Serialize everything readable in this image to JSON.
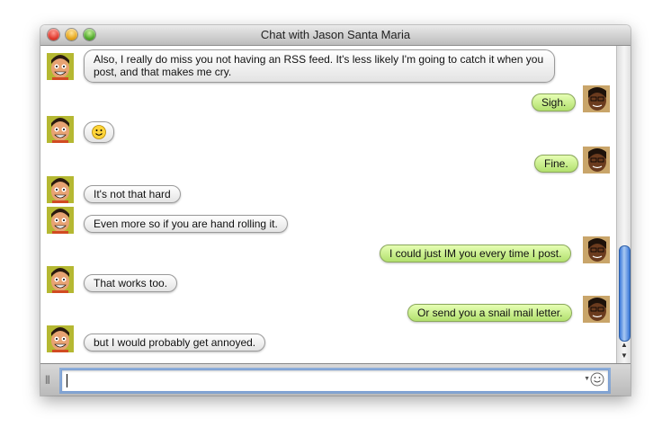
{
  "window": {
    "title": "Chat with Jason Santa Maria"
  },
  "messages": [
    {
      "side": "left",
      "text": "Also, I really do miss you not having an RSS feed. It's less likely I'm going to catch it when you post, and that makes me cry.",
      "avatar": "cartoon-face-icon"
    },
    {
      "side": "right",
      "text": "Sigh.",
      "avatar": "cartoon-face-icon"
    },
    {
      "side": "left",
      "text": "",
      "emoji": "🙂",
      "avatar": "cartoon-face-icon"
    },
    {
      "side": "right",
      "text": "Fine.",
      "avatar": "cartoon-face-icon"
    },
    {
      "side": "left",
      "text": "It's not that hard",
      "avatar": "cartoon-face-icon"
    },
    {
      "side": "left",
      "text": "Even more so if you are hand rolling it.",
      "avatar": "cartoon-face-icon"
    },
    {
      "side": "right",
      "text": "I could just IM you every time I post.",
      "avatar": "cartoon-face-icon"
    },
    {
      "side": "left",
      "text": "That works too.",
      "avatar": "cartoon-face-icon"
    },
    {
      "side": "right",
      "text": "Or send you a snail mail letter.",
      "avatar": "cartoon-face-icon"
    },
    {
      "side": "left",
      "text": "but I would probably get annoyed.",
      "avatar": "cartoon-face-icon"
    }
  ],
  "input": {
    "value": ""
  },
  "colors": {
    "left_bubble": "#f2f2f2",
    "right_bubble": "#c6ec8c",
    "scroll_thumb": "#3b78d9"
  }
}
